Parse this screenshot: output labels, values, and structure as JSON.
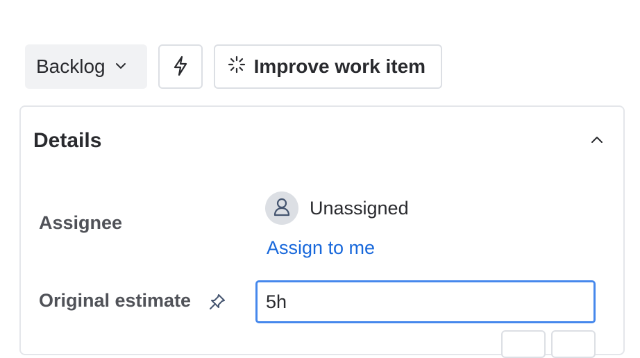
{
  "toolbar": {
    "status_label": "Backlog",
    "automation_icon": "lightning-bolt-icon",
    "improve_label": "Improve work item",
    "improve_icon": "sparkle-loader-icon"
  },
  "details": {
    "title": "Details",
    "assignee": {
      "label": "Assignee",
      "value": "Unassigned",
      "assign_link": "Assign to me"
    },
    "original_estimate": {
      "label": "Original estimate",
      "value": "5h"
    }
  },
  "colors": {
    "link": "#1868db",
    "focus_border": "#4688ec",
    "status_bg": "#f1f2f4"
  }
}
